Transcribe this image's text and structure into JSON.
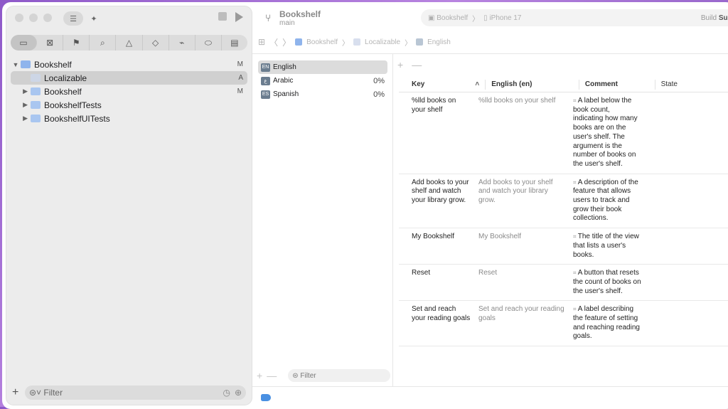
{
  "sidebar": {
    "nav_tabs": [
      "folder-icon",
      "xmark-box-icon",
      "bookmark-icon",
      "search-icon",
      "warning-icon",
      "diamond-icon",
      "tag-spray-icon",
      "label-icon",
      "report-icon"
    ],
    "tree": [
      {
        "label": "Bookshelf",
        "badge": "M",
        "level": 0,
        "expanded": true,
        "icon": "project"
      },
      {
        "label": "Localizable",
        "badge": "A",
        "level": 1,
        "selected": true,
        "icon": "strings"
      },
      {
        "label": "Bookshelf",
        "badge": "M",
        "level": 1,
        "expanded": false,
        "icon": "folder"
      },
      {
        "label": "BookshelfTests",
        "badge": "",
        "level": 1,
        "expanded": false,
        "icon": "folder"
      },
      {
        "label": "BookshelfUITests",
        "badge": "",
        "level": 1,
        "expanded": false,
        "icon": "folder"
      }
    ],
    "filter_placeholder": "Filter"
  },
  "toolbar": {
    "project": "Bookshelf",
    "branch": "main",
    "scheme": "Bookshelf",
    "device": "iPhone 17",
    "status_prefix": "Build ",
    "status_bold": "Succeed"
  },
  "breadcrumb": [
    "Bookshelf",
    "Localizable",
    "English"
  ],
  "languages": [
    {
      "code": "EN",
      "name": "English",
      "pct": "",
      "selected": true
    },
    {
      "code": "ع",
      "name": "Arabic",
      "pct": "0%",
      "selected": false
    },
    {
      "code": "ES",
      "name": "Spanish",
      "pct": "0%",
      "selected": false
    }
  ],
  "lang_filter_placeholder": "Filter",
  "table": {
    "headers": {
      "key": "Key",
      "english": "English (en)",
      "comment": "Comment",
      "state": "State"
    },
    "rows": [
      {
        "key": "%lld books on your shelf",
        "english": "%lld books on your shelf",
        "comment": "A label below the book count, indicating how many books are on the user's shelf. The argument is the number of books on the user's shelf."
      },
      {
        "key": "Add books to your shelf and watch your library grow.",
        "english": "Add books to your shelf and watch your library grow.",
        "comment": "A description of the feature that allows users to track and grow their book collections."
      },
      {
        "key": "My Bookshelf",
        "english": "My Bookshelf",
        "comment": "The title of the view that lists a user's books."
      },
      {
        "key": "Reset",
        "english": "Reset",
        "comment": "A button that resets the count of books on the user's shelf."
      },
      {
        "key": "Set and reach your reading goals",
        "english": "Set and reach your reading goals",
        "comment": "A label describing the feature of setting and reaching reading goals."
      }
    ]
  }
}
